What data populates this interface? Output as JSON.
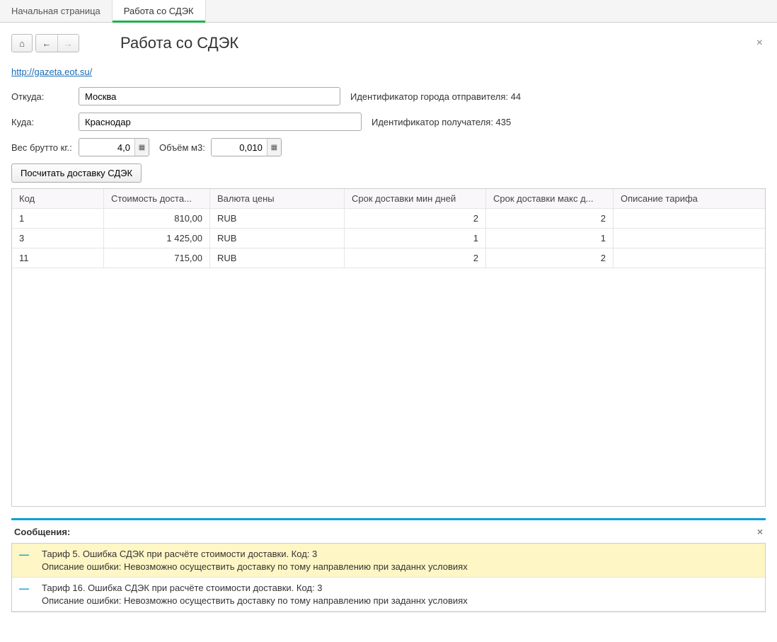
{
  "tabs": [
    {
      "label": "Начальная страница",
      "active": false
    },
    {
      "label": "Работа со СДЭК",
      "active": true
    }
  ],
  "page_title": "Работа со СДЭК",
  "link_url": "http://gazeta.eot.su/",
  "form": {
    "from_label": "Откуда:",
    "from_value": "Москва",
    "from_id_text": "Идентификатор города отправителя: 44",
    "to_label": "Куда:",
    "to_value": "Краснодар",
    "to_id_text": "Идентификатор получателя: 435",
    "weight_label": "Вес брутто кг.:",
    "weight_value": "4,0",
    "volume_label": "Объём м3:",
    "volume_value": "0,010"
  },
  "calc_button": "Посчитать доставку СДЭК",
  "grid": {
    "headers": [
      "Код",
      "Стоимость доста...",
      "Валюта цены",
      "Срок доставки мин дней",
      "Срок доставки макс д...",
      "Описание тарифа"
    ],
    "rows": [
      {
        "code": "1",
        "cost": "810,00",
        "currency": "RUB",
        "min": "2",
        "max": "2",
        "desc": ""
      },
      {
        "code": "3",
        "cost": "1 425,00",
        "currency": "RUB",
        "min": "1",
        "max": "1",
        "desc": ""
      },
      {
        "code": "11",
        "cost": "715,00",
        "currency": "RUB",
        "min": "2",
        "max": "2",
        "desc": ""
      }
    ]
  },
  "messages": {
    "title": "Сообщения:",
    "items": [
      {
        "highlight": true,
        "line1": "Тариф 5. Ошибка СДЭК при расчёте стоимости доставки. Код: 3",
        "line2": "Описание ошибки: Невозможно осуществить доставку по тому направлению при заданнх условиях"
      },
      {
        "highlight": false,
        "line1": "Тариф 16. Ошибка СДЭК при расчёте стоимости доставки. Код: 3",
        "line2": "Описание ошибки: Невозможно осуществить доставку по тому направлению при заданнх условиях"
      }
    ]
  }
}
